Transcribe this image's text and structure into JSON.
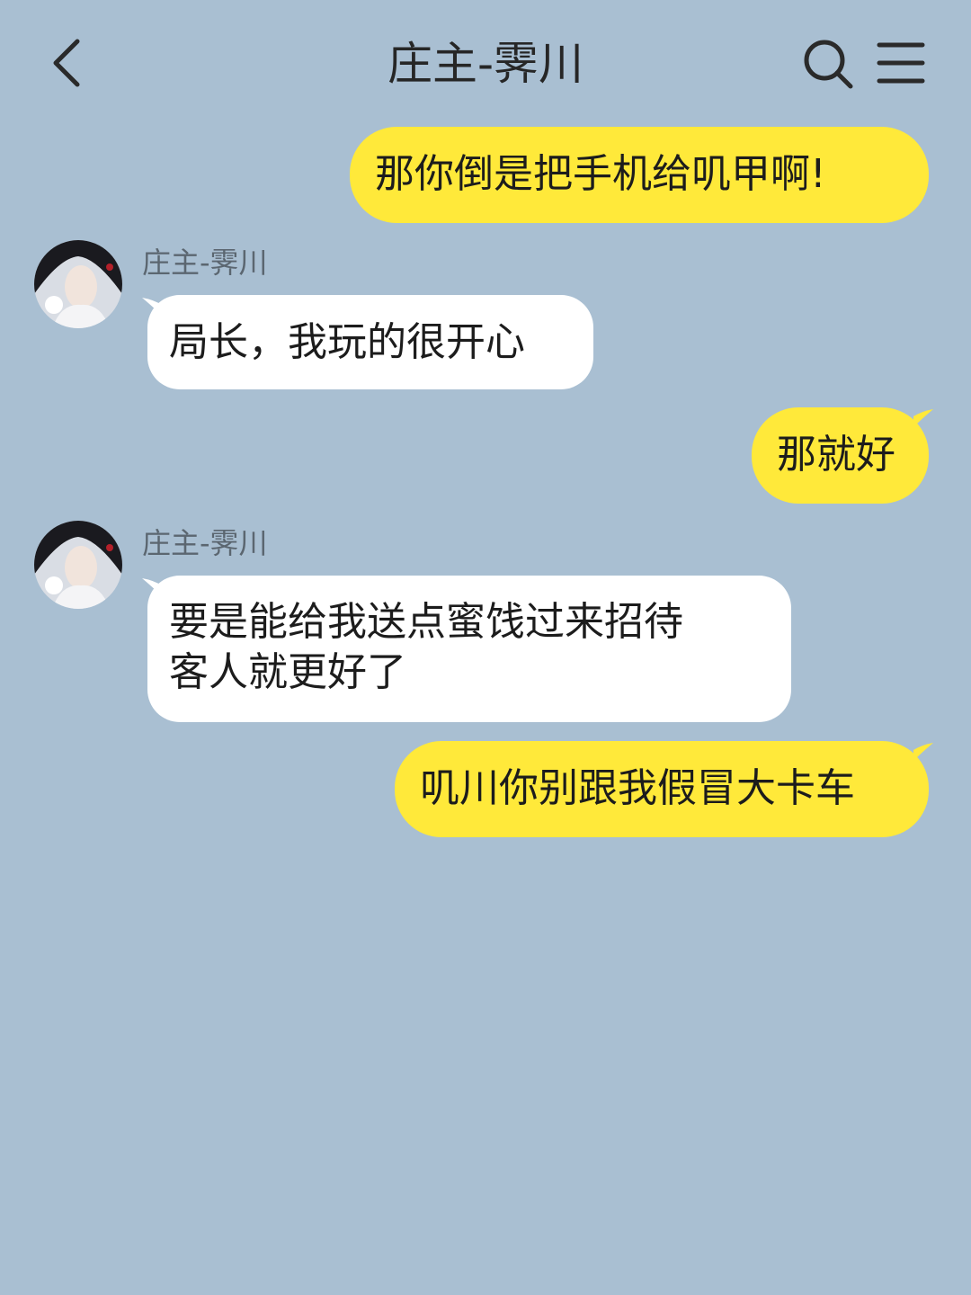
{
  "header": {
    "title": "庄主-霁川",
    "back_icon": "chevron-left-icon",
    "search_icon": "search-icon",
    "menu_icon": "menu-icon"
  },
  "colors": {
    "background": "#a9bfd2",
    "my_bubble": "#ffe93a",
    "their_bubble": "#ffffff"
  },
  "messages": [
    {
      "from": "me",
      "text": "那你倒是把手机给叽甲啊!"
    },
    {
      "from": "them",
      "sender": "庄主-霁川",
      "text": "局长，我玩的很开心"
    },
    {
      "from": "me",
      "text": "那就好"
    },
    {
      "from": "them",
      "sender": "庄主-霁川",
      "lines": [
        "要是能给我送点蜜饯过来招待",
        "客人就更好了"
      ]
    },
    {
      "from": "me",
      "text": "叽川你别跟我假冒大卡车"
    }
  ]
}
